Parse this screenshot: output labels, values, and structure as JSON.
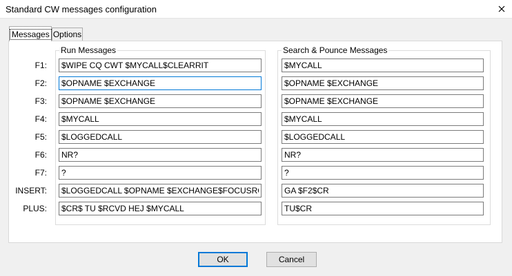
{
  "window": {
    "title": "Standard CW messages configuration",
    "close_symbol": "×"
  },
  "tabs": [
    {
      "label": "Messages",
      "active": true
    },
    {
      "label": "Options",
      "active": false
    }
  ],
  "groups": {
    "run_title": "Run Messages",
    "sp_title": "Search & Pounce Messages"
  },
  "rows": [
    {
      "label": "F1:",
      "run": "$WIPE CQ CWT $MYCALL$CLEARRIT",
      "sp": "$MYCALL"
    },
    {
      "label": "F2:",
      "run": "$OPNAME $EXCHANGE",
      "sp": "$OPNAME $EXCHANGE"
    },
    {
      "label": "F3:",
      "run": "$OPNAME $EXCHANGE",
      "sp": "$OPNAME $EXCHANGE"
    },
    {
      "label": "F4:",
      "run": "$MYCALL",
      "sp": "$MYCALL"
    },
    {
      "label": "F5:",
      "run": "$LOGGEDCALL",
      "sp": "$LOGGEDCALL"
    },
    {
      "label": "F6:",
      "run": "NR?",
      "sp": "NR?"
    },
    {
      "label": "F7:",
      "run": "?",
      "sp": "?"
    },
    {
      "label": "INSERT:",
      "run": "$LOGGEDCALL $OPNAME $EXCHANGE$FOCUSRCVD",
      "sp": "GA $F2$CR"
    },
    {
      "label": "PLUS:",
      "run": "$CR$ TU $RCVD HEJ $MYCALL",
      "sp": "TU$CR"
    }
  ],
  "buttons": {
    "ok": "OK",
    "cancel": "Cancel"
  },
  "colors": {
    "focus": "#0078d7",
    "background": "#f0f0f0"
  }
}
